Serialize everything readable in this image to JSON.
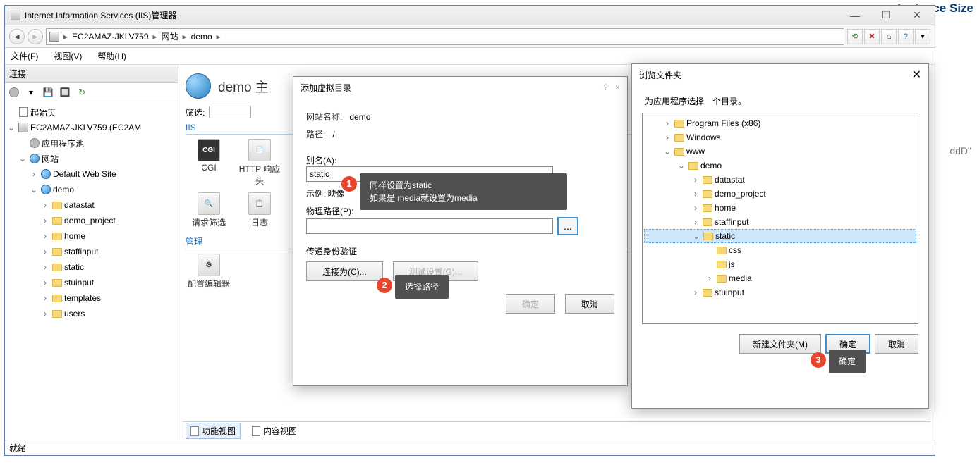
{
  "window": {
    "title": "Internet Information Services (IIS)管理器",
    "breadcrumb": [
      "EC2AMAZ-JKLV759",
      "网站",
      "demo"
    ],
    "menu": {
      "file": "文件(F)",
      "view": "视图(V)",
      "help": "帮助(H)"
    },
    "refresh_tool": "↻"
  },
  "connections": {
    "header": "连接",
    "tree": {
      "start": "起始页",
      "server": "EC2AMAZ-JKLV759 (EC2AM",
      "app_pools": "应用程序池",
      "sites": "网站",
      "default_site": "Default Web Site",
      "demo": "demo",
      "children": [
        "datastat",
        "demo_project",
        "home",
        "staffinput",
        "static",
        "stuinput",
        "templates",
        "users"
      ]
    }
  },
  "center": {
    "title": "demo 主",
    "filter_label": "筛选:",
    "section_iis": "IIS",
    "section_mgmt": "管理",
    "icons": {
      "cgi": "CGI",
      "http": "HTTP 响应头",
      "filter": "请求筛选",
      "log": "日志",
      "cfg": "配置编辑器"
    },
    "view_feature": "功能视图",
    "view_content": "内容视图"
  },
  "dlg_virtual": {
    "title": "添加虚拟目录",
    "site_label": "网站名称:",
    "site_value": "demo",
    "path_label": "路径:",
    "path_value": "/",
    "alias_label": "别名(A):",
    "alias_value": "static",
    "example_label": "示例: 映像",
    "phys_label": "物理路径(P):",
    "phys_value": "",
    "auth_label": "传递身份验证",
    "connect_as": "连接为(C)...",
    "test": "测试设置(G)...",
    "ok": "确定",
    "cancel": "取消"
  },
  "dlg_browse": {
    "title": "浏览文件夹",
    "instruction": "为应用程序选择一个目录。",
    "tree": {
      "pf": "Program Files (x86)",
      "win": "Windows",
      "www": "www",
      "demo": "demo",
      "children": [
        "datastat",
        "demo_project",
        "home",
        "staffinput"
      ],
      "static": "static",
      "static_children": [
        "css",
        "js",
        "media"
      ],
      "stuinput": "stuinput"
    },
    "new_folder": "新建文件夹(M)",
    "ok": "确定",
    "cancel": "取消"
  },
  "annotations": {
    "a1_line1": "同样设置为static",
    "a1_line2": "如果是 media就设置为media",
    "a2": "选择路径",
    "a3": "确定"
  },
  "status": "就绪",
  "side": {
    "instance": "Instance Size",
    "ddd": "ddD\""
  }
}
